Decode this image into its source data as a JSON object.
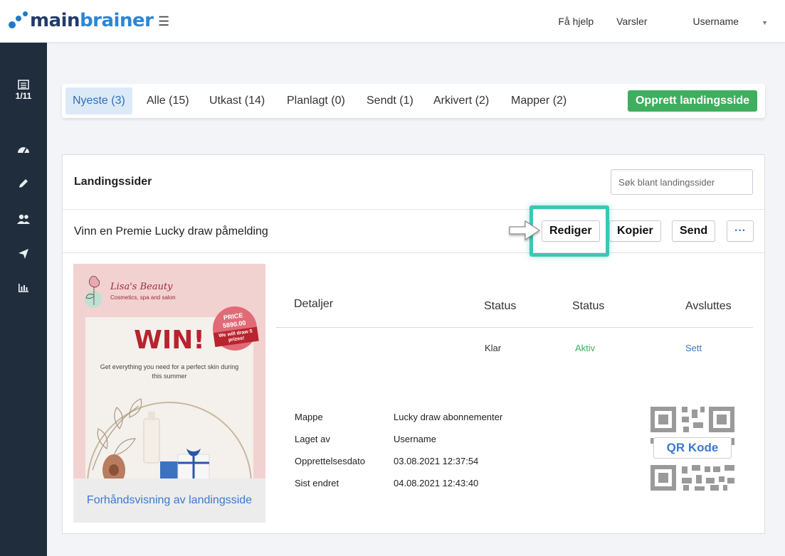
{
  "brand": {
    "prefix": "main",
    "suffix": "brainer"
  },
  "topnav": {
    "help": "Få hjelp",
    "alerts": "Varsler",
    "user": "Username"
  },
  "sidebar": {
    "counter": "1/11"
  },
  "tabs": [
    {
      "label": "Nyeste (3)",
      "active": true
    },
    {
      "label": "Alle (15)"
    },
    {
      "label": "Utkast (14)"
    },
    {
      "label": "Planlagt (0)"
    },
    {
      "label": "Sendt (1)"
    },
    {
      "label": "Arkivert (2)"
    },
    {
      "label": "Mapper (2)"
    }
  ],
  "create_button": "Opprett landingsside",
  "panel": {
    "title": "Landingssider",
    "search_placeholder": "Søk blant landingssider"
  },
  "item": {
    "title": "Vinn en Premie Lucky draw påmelding",
    "actions": {
      "edit": "Rediger",
      "copy": "Kopier",
      "send": "Send",
      "more": "···"
    }
  },
  "preview": {
    "brand": "Lisa's Beauty",
    "brand_sub": "Cosmetics, spa and salon",
    "price_line1": "PRICE",
    "price_line2": "5890.00",
    "price_sub": "We will draw 5 prizes!",
    "headline": "WIN!",
    "tagline": "Get everything you need for a perfect skin during this summer",
    "footer": "Forhåndsvisning av landingsside"
  },
  "details": {
    "headers": {
      "details": "Detaljer",
      "status1": "Status",
      "status2": "Status",
      "ends": "Avsluttes"
    },
    "values": {
      "status1": "Klar",
      "status2": "Aktiv",
      "ends": "Sett"
    },
    "meta": [
      {
        "key": "Mappe",
        "value": "Lucky draw abonnementer"
      },
      {
        "key": "Laget av",
        "value": "Username"
      },
      {
        "key": "Opprettelsesdato",
        "value": "03.08.2021 12:37:54"
      },
      {
        "key": "Sist endret",
        "value": "04.08.2021 12:43:40"
      }
    ],
    "qr_label": "QR Kode"
  },
  "colors": {
    "accent": "#3fae5e",
    "link": "#3a78d1",
    "active_status": "#3fae5e",
    "highlight": "#3cc7b4",
    "sidebar": "#1f2d3d"
  }
}
